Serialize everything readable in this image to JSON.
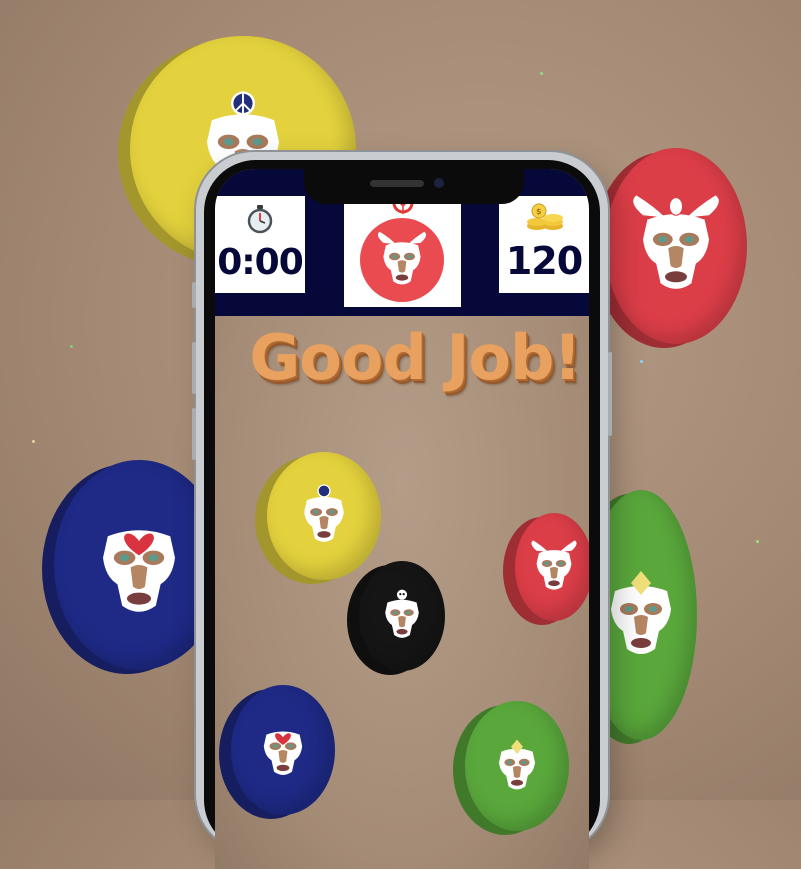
{
  "hud": {
    "timer_icon": "stopwatch-icon",
    "timer_value": "0:00",
    "target_icon": "target-icon",
    "target_token": "red-luchador-mask-token",
    "coins_icon": "coin-stack-icon",
    "coins_value": "120"
  },
  "message": "Good Job!",
  "tokens": [
    {
      "color": "yellow",
      "emblem": "peace-symbol"
    },
    {
      "color": "red",
      "emblem": "angel-wings"
    },
    {
      "color": "blue",
      "emblem": "heart"
    },
    {
      "color": "green",
      "emblem": "diamond"
    },
    {
      "color": "black",
      "emblem": "skull"
    }
  ],
  "colors": {
    "hud_background": "#06083a",
    "hud_text": "#06083a",
    "headline": "#e8a15e",
    "token_yellow": "#e3d13d",
    "token_red": "#dc3e48",
    "token_blue": "#1e2a86",
    "token_green": "#5aa83c",
    "token_black": "#151515"
  }
}
